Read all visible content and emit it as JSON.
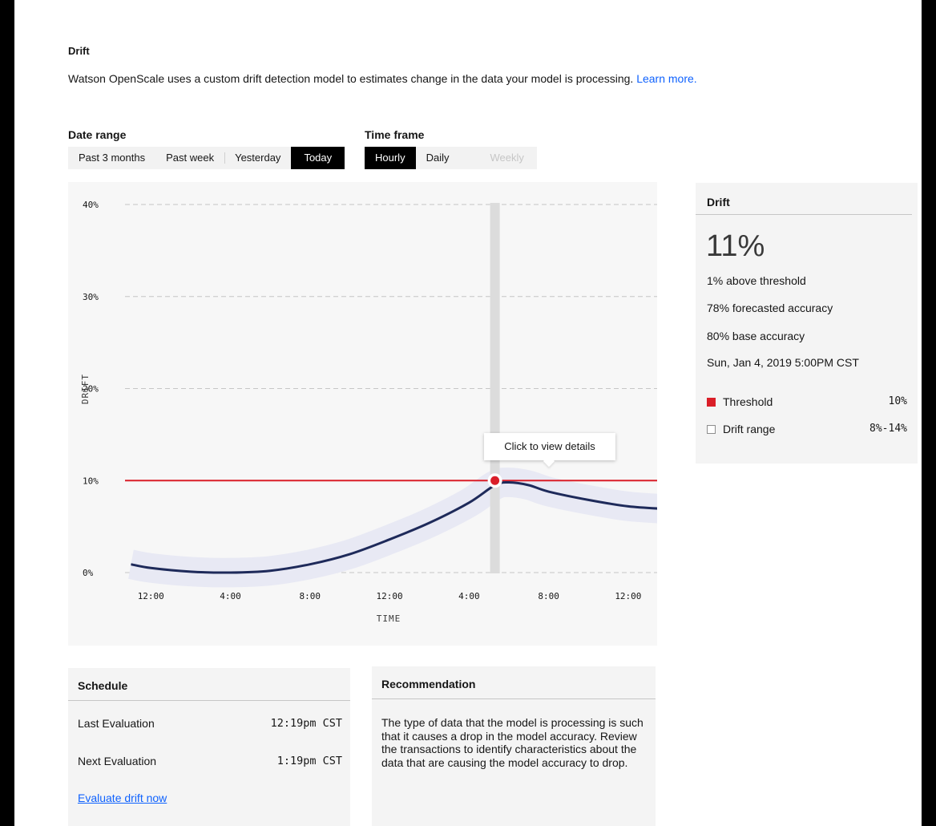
{
  "header": {
    "title": "Drift",
    "description": "Watson OpenScale uses a custom drift detection model to estimates change in the data your model is processing.",
    "learn_more": "Learn more."
  },
  "date_range": {
    "label": "Date range",
    "options": [
      "Past 3 months",
      "Past week",
      "Yesterday",
      "Today"
    ],
    "selected": "Today"
  },
  "time_frame": {
    "label": "Time frame",
    "options": [
      "Hourly",
      "Daily",
      "Weekly"
    ],
    "selected": "Hourly",
    "disabled": [
      "Weekly"
    ]
  },
  "chart_data": {
    "type": "line",
    "xlabel": "TIME",
    "ylabel": "DRIFT",
    "y_ticks": [
      "0%",
      "10%",
      "20%",
      "30%",
      "40%"
    ],
    "x_ticks": [
      "12:00",
      "4:00",
      "8:00",
      "12:00",
      "4:00",
      "8:00",
      "12:00"
    ],
    "ylim": [
      0,
      40
    ],
    "x_hours": [
      -1,
      0,
      2,
      4,
      6,
      8,
      10,
      12,
      14,
      16,
      17.3,
      18,
      19,
      20,
      22,
      24,
      26
    ],
    "drift": [
      0.9,
      0.5,
      0.1,
      0.0,
      0.2,
      0.9,
      2.0,
      3.6,
      5.4,
      7.6,
      9.5,
      9.8,
      9.5,
      8.8,
      7.9,
      7.2,
      6.9
    ],
    "band_spread": 1.6,
    "threshold": 10,
    "selected_x": 17.3,
    "selected_drift": 10,
    "grid": true,
    "tooltip": "Click to view details",
    "colors": {
      "line": "#1e2a5a",
      "band": "#e8e9f4",
      "threshold": "#da1e28",
      "grid": "#c6c6c6",
      "cursor": "#dcdcdc"
    }
  },
  "summary": {
    "title": "Drift",
    "value": "11%",
    "lines": [
      "1% above threshold",
      "78% forecasted accuracy",
      "80% base accuracy",
      "Sun, Jan 4, 2019  5:00PM CST"
    ],
    "legend": [
      {
        "label": "Threshold",
        "value": "10%",
        "color": "#da1e28"
      },
      {
        "label": "Drift range",
        "value": "8%-14%",
        "color": "#ffffff"
      }
    ]
  },
  "schedule": {
    "title": "Schedule",
    "last_label": "Last Evaluation",
    "last_value": "12:19pm CST",
    "next_label": "Next Evaluation",
    "next_value": "1:19pm CST",
    "action": "Evaluate drift now"
  },
  "recommendation": {
    "title": "Recommendation",
    "text": "The type of data that the model is processing is such that it causes a drop in the model accuracy. Review the transactions to identify characteristics about the data that are causing the model accuracy to drop."
  }
}
